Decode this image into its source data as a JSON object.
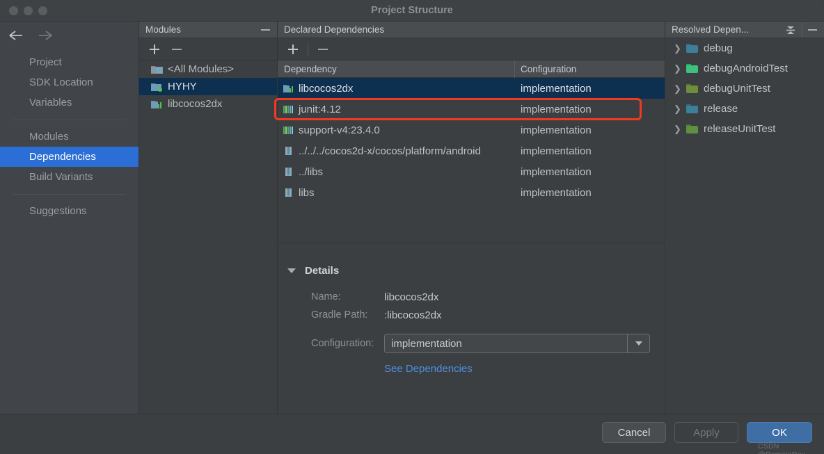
{
  "window": {
    "title": "Project Structure",
    "traffic_lights": [
      "close-dot",
      "minimize-dot",
      "maximize-dot"
    ]
  },
  "sidebar": {
    "back_icon": "back-arrow-icon",
    "forward_icon": "forward-arrow-icon",
    "groups": [
      {
        "items": [
          {
            "label": "Project",
            "selected": false
          },
          {
            "label": "SDK Location",
            "selected": false
          },
          {
            "label": "Variables",
            "selected": false
          }
        ]
      },
      {
        "items": [
          {
            "label": "Modules",
            "selected": false
          },
          {
            "label": "Dependencies",
            "selected": true
          },
          {
            "label": "Build Variants",
            "selected": false
          }
        ]
      },
      {
        "items": [
          {
            "label": "Suggestions",
            "selected": false
          }
        ]
      }
    ],
    "selected_color": "#2b6ed6"
  },
  "modules_panel": {
    "title": "Modules",
    "minimize_icon": "minimize-icon",
    "toolbar": {
      "add_icon": "plus-icon",
      "remove_icon": "minus-icon"
    },
    "items": [
      {
        "label": "<All Modules>",
        "icon": "all-modules-icon",
        "selected": false
      },
      {
        "label": "HYHY",
        "icon": "module-folder-icon",
        "selected": true
      },
      {
        "label": "libcocos2dx",
        "icon": "library-module-icon",
        "selected": false
      }
    ]
  },
  "declared_panel": {
    "title": "Declared Dependencies",
    "toolbar": {
      "add_icon": "plus-icon",
      "remove_icon": "minus-icon"
    },
    "columns": [
      "Dependency",
      "Configuration"
    ],
    "rows": [
      {
        "dependency": "libcocos2dx",
        "configuration": "implementation",
        "icon": "module-icon",
        "selected": true,
        "highlighted": false
      },
      {
        "dependency": "junit:4.12",
        "configuration": "implementation",
        "icon": "library-icon",
        "selected": false,
        "highlighted": true
      },
      {
        "dependency": "support-v4:23.4.0",
        "configuration": "implementation",
        "icon": "library-icon",
        "selected": false,
        "highlighted": false
      },
      {
        "dependency": "../../../cocos2d-x/cocos/platform/android",
        "configuration": "implementation",
        "icon": "jar-file-icon",
        "selected": false,
        "highlighted": false
      },
      {
        "dependency": "../libs",
        "configuration": "implementation",
        "icon": "jar-file-icon",
        "selected": false,
        "highlighted": false
      },
      {
        "dependency": "libs",
        "configuration": "implementation",
        "icon": "jar-file-icon",
        "selected": false,
        "highlighted": false
      }
    ],
    "highlight_color": "#f23a21"
  },
  "details": {
    "title": "Details",
    "expander_icon": "triangle-down-icon",
    "name_label": "Name:",
    "name_value": "libcocos2dx",
    "gradle_path_label": "Gradle Path:",
    "gradle_path_value": ":libcocos2dx",
    "configuration_label": "Configuration:",
    "configuration_value": "implementation",
    "dropdown_icon": "chevron-down-icon",
    "see_dependencies_link": "See Dependencies",
    "link_color": "#4a90e2"
  },
  "resolved_panel": {
    "title": "Resolved Depen...",
    "collapse_icon": "collapse-all-icon",
    "minimize_icon": "minimize-icon",
    "items": [
      {
        "label": "debug",
        "color": "#3d7e9a",
        "expand_icon": "chevron-right-icon"
      },
      {
        "label": "debugAndroidTest",
        "color": "#3cc27e",
        "expand_icon": "chevron-right-icon"
      },
      {
        "label": "debugUnitTest",
        "color": "#6d8e3a",
        "expand_icon": "chevron-right-icon"
      },
      {
        "label": "release",
        "color": "#3d7e9a",
        "expand_icon": "chevron-right-icon"
      },
      {
        "label": "releaseUnitTest",
        "color": "#5f9040",
        "expand_icon": "chevron-right-icon"
      }
    ]
  },
  "footer": {
    "cancel_label": "Cancel",
    "apply_label": "Apply",
    "ok_label": "OK",
    "watermark": "CSDN @RemoteDev"
  }
}
